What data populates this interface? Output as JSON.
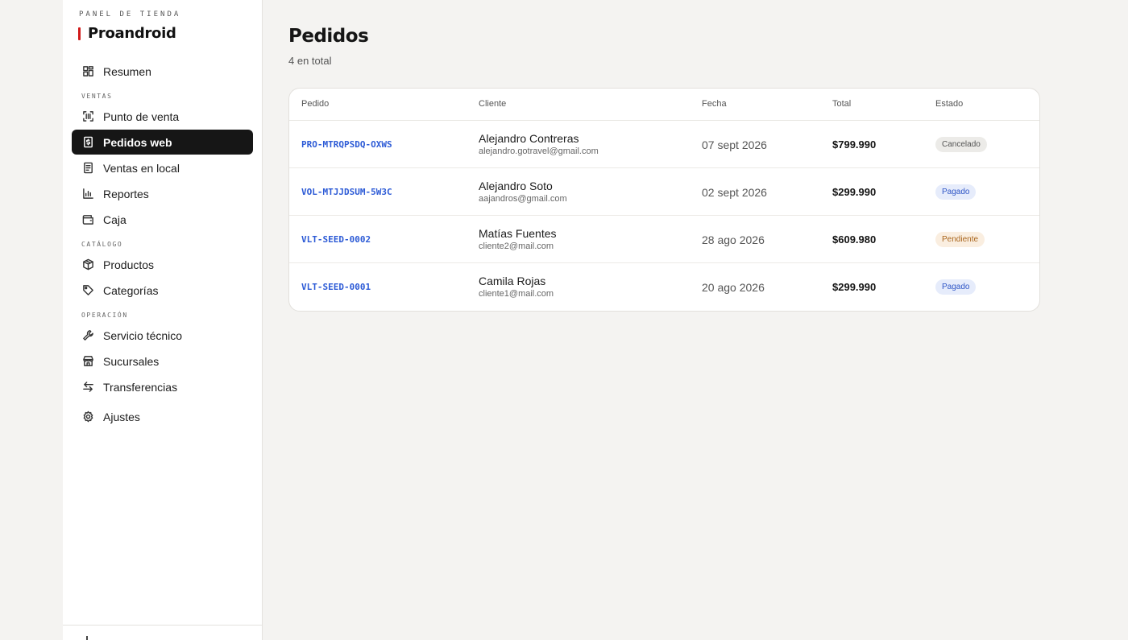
{
  "sidebar": {
    "subtitle": "PANEL DE TIENDA",
    "brand": "Proandroid",
    "items": {
      "resumen": "Resumen",
      "punto_venta": "Punto de venta",
      "pedidos_web": "Pedidos web",
      "ventas_local": "Ventas en local",
      "reportes": "Reportes",
      "caja": "Caja",
      "productos": "Productos",
      "categorias": "Categorías",
      "servicio": "Servicio técnico",
      "sucursales": "Sucursales",
      "transferencias": "Transferencias",
      "ajustes": "Ajustes"
    },
    "sections": {
      "ventas": "VENTAS",
      "catalogo": "CATÁLOGO",
      "operacion": "OPERACIÓN"
    },
    "active_item": "Pedidos web",
    "accent_color": "#d11a1a"
  },
  "page": {
    "title": "Pedidos",
    "subtitle": "4 en total"
  },
  "table": {
    "headers": {
      "pedido": "Pedido",
      "cliente": "Cliente",
      "fecha": "Fecha",
      "total": "Total",
      "estado": "Estado"
    },
    "rows": [
      {
        "id": "PRO-MTRQPSDQ-OXWS",
        "name": "Alejandro Contreras",
        "email": "alejandro.gotravel@gmail.com",
        "date": "07 sept 2026",
        "total": "$799.990",
        "status": "Cancelado"
      },
      {
        "id": "VOL-MTJJDSUM-5W3C",
        "name": "Alejandro Soto",
        "email": "aajandros@gmail.com",
        "date": "02 sept 2026",
        "total": "$299.990",
        "status": "Pagado"
      },
      {
        "id": "VLT-SEED-0002",
        "name": "Matías Fuentes",
        "email": "cliente2@mail.com",
        "date": "28 ago 2026",
        "total": "$609.980",
        "status": "Pendiente"
      },
      {
        "id": "VLT-SEED-0001",
        "name": "Camila Rojas",
        "email": "cliente1@mail.com",
        "date": "20 ago 2026",
        "total": "$299.990",
        "status": "Pagado"
      }
    ]
  },
  "icons": {
    "resumen": "grid-icon",
    "punto_venta": "barcode-scan-icon",
    "pedidos_web": "receipt-dollar-icon",
    "ventas_local": "document-list-icon",
    "reportes": "bar-chart-icon",
    "caja": "wallet-icon",
    "productos": "box-icon",
    "categorias": "tag-icon",
    "servicio": "wrench-icon",
    "sucursales": "store-icon",
    "transferencias": "arrows-swap-icon",
    "ajustes": "gear-icon"
  }
}
